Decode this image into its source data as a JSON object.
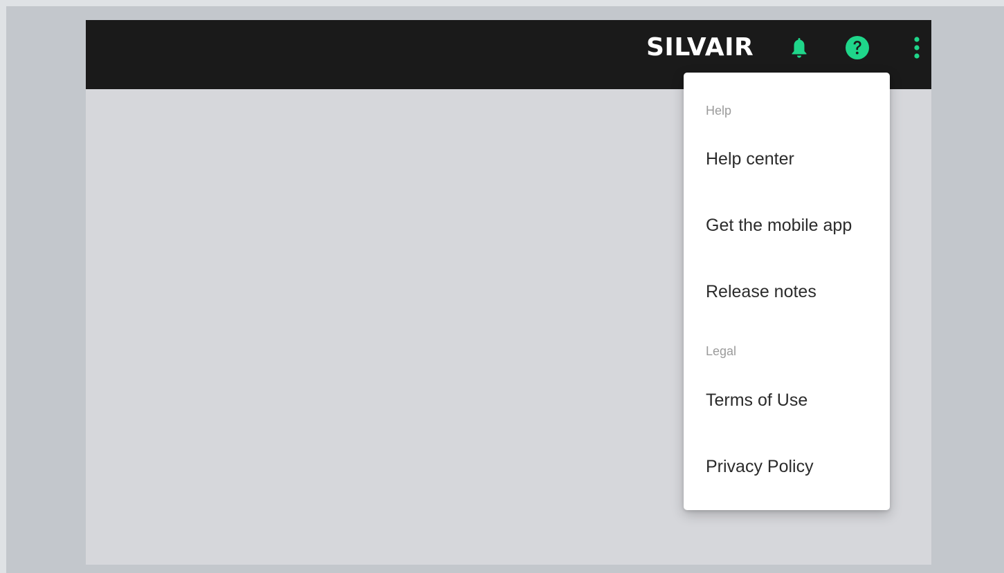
{
  "header": {
    "brand": "SILVAIR",
    "icons": {
      "notifications": "bell-icon",
      "help": "help-circle-icon",
      "more": "more-vertical-icon"
    }
  },
  "menu": {
    "sections": [
      {
        "label": "Help",
        "items": [
          "Help center",
          "Get the mobile app",
          "Release notes"
        ]
      },
      {
        "label": "Legal",
        "items": [
          "Terms of Use",
          "Privacy Policy"
        ]
      }
    ]
  },
  "colors": {
    "accent": "#1fd68a",
    "topbar": "#1a1a1a",
    "content_bg": "#d6d7db",
    "outer_bg": "#c3c7cc"
  }
}
